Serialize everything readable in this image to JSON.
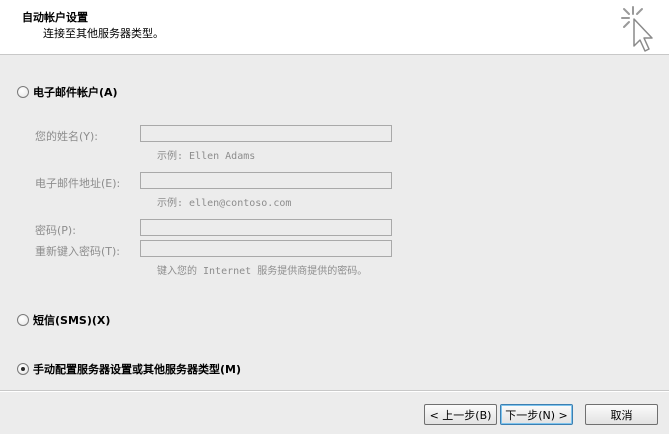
{
  "header": {
    "title": "自动帐户设置",
    "subtitle": "连接至其他服务器类型。",
    "icon": "cursor-click-icon"
  },
  "email_account": {
    "option_label": "电子邮件帐户(A)",
    "selected": false,
    "name_label": "您的姓名(Y):",
    "name_value": "",
    "name_hint": "示例: Ellen Adams",
    "email_label": "电子邮件地址(E):",
    "email_value": "",
    "email_hint": "示例: ellen@contoso.com",
    "password_label": "密码(P):",
    "password_value": "",
    "retype_label": "重新键入密码(T):",
    "retype_value": "",
    "password_hint": "键入您的 Internet 服务提供商提供的密码。"
  },
  "sms": {
    "option_label": "短信(SMS)(X)",
    "selected": false
  },
  "manual": {
    "option_label": "手动配置服务器设置或其他服务器类型(M)",
    "selected": true
  },
  "footer": {
    "back_label": "< 上一步(B)",
    "next_label": "下一步(N) >",
    "cancel_label": "取消"
  }
}
